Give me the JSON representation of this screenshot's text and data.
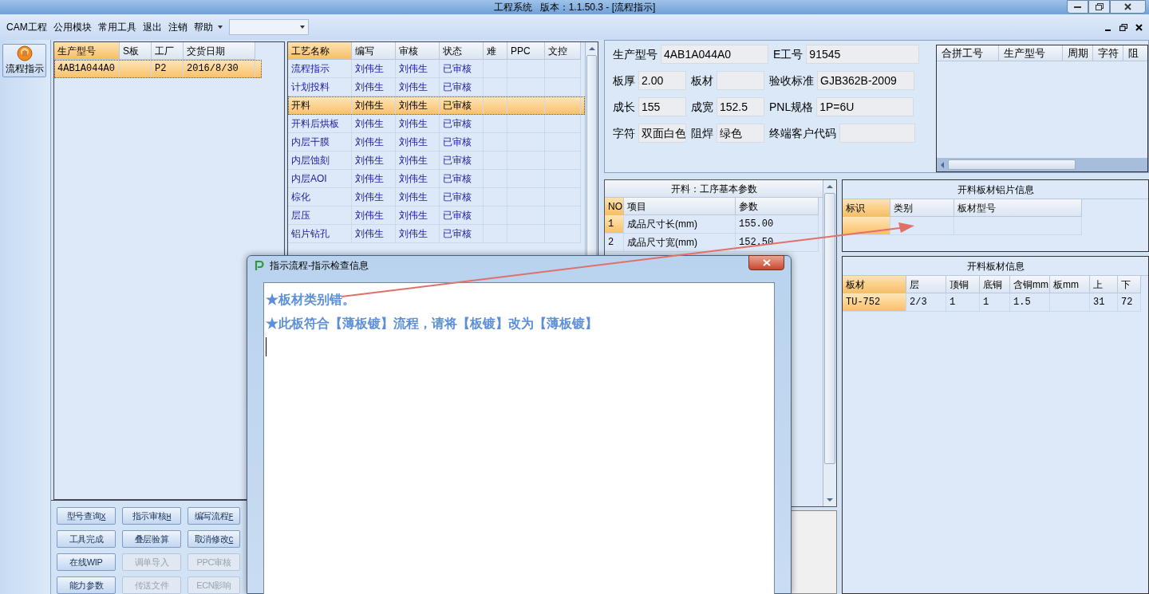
{
  "window": {
    "title": "工程系统   版本：1.1.50.3 - [流程指示]"
  },
  "menu": [
    {
      "label": "CAM工程"
    },
    {
      "label": "公用模块"
    },
    {
      "label": "常用工具"
    },
    {
      "label": "退出"
    },
    {
      "label": "注销"
    },
    {
      "label": "帮助",
      "dropdown": true
    }
  ],
  "nav": [
    {
      "label": "流程指示",
      "selected": true
    }
  ],
  "jobs": {
    "columns": [
      {
        "label": "生产型号",
        "highlighted": true
      },
      {
        "label": "S板",
        "highlighted": false
      },
      {
        "label": "工厂",
        "highlighted": false
      },
      {
        "label": "交货日期",
        "highlighted": false
      }
    ],
    "rows": [
      {
        "model": "4AB1A044A0",
        "factory": "P2",
        "delivery_date": "2016/8/30",
        "selected": true
      }
    ]
  },
  "process": {
    "columns": [
      {
        "label": "工艺名称",
        "highlighted": true
      },
      {
        "label": "编写",
        "highlighted": false
      },
      {
        "label": "审核",
        "highlighted": false
      },
      {
        "label": "状态",
        "highlighted": false
      },
      {
        "label": "难",
        "highlighted": false
      },
      {
        "label": "PPC",
        "highlighted": false
      },
      {
        "label": "文控",
        "highlighted": false
      }
    ],
    "rows": [
      {
        "name": "流程指示",
        "writer": "刘伟生",
        "reviewer": "刘伟生",
        "status": "已审核",
        "selected": false
      },
      {
        "name": "计划投料",
        "writer": "刘伟生",
        "reviewer": "刘伟生",
        "status": "已审核",
        "selected": false
      },
      {
        "name": "开料",
        "writer": "刘伟生",
        "reviewer": "刘伟生",
        "status": "已审核",
        "selected": true
      },
      {
        "name": "开料后烘板",
        "writer": "刘伟生",
        "reviewer": "刘伟生",
        "status": "已审核",
        "selected": false
      },
      {
        "name": "内层干膜",
        "writer": "刘伟生",
        "reviewer": "刘伟生",
        "status": "已审核",
        "selected": false
      },
      {
        "name": "内层蚀刻",
        "writer": "刘伟生",
        "reviewer": "刘伟生",
        "status": "已审核",
        "selected": false
      },
      {
        "name": "内层AOI",
        "writer": "刘伟生",
        "reviewer": "刘伟生",
        "status": "已审核",
        "selected": false
      },
      {
        "name": "棕化",
        "writer": "刘伟生",
        "reviewer": "刘伟生",
        "status": "已审核",
        "selected": false
      },
      {
        "name": "层压",
        "writer": "刘伟生",
        "reviewer": "刘伟生",
        "status": "已审核",
        "selected": false
      },
      {
        "name": "铝片钻孔",
        "writer": "刘伟生",
        "reviewer": "刘伟生",
        "status": "已审核",
        "selected": false
      }
    ]
  },
  "info": [
    [
      {
        "label": "生产型号",
        "value": "4AB1A044A0"
      },
      {
        "label": "E工号",
        "value": "91545"
      }
    ],
    [
      {
        "label": "板厚",
        "value": "2.00"
      },
      {
        "label": "板材"
      },
      {
        "label": "验收标准",
        "value": "GJB362B-2009"
      }
    ],
    [
      {
        "label": "成长",
        "value": "155"
      },
      {
        "label": "成宽",
        "value": "152.5"
      },
      {
        "label": "PNL规格",
        "value": "1P=6U"
      }
    ],
    [
      {
        "label": "字符",
        "value": "双面白色"
      },
      {
        "label": "阻焊",
        "value": "绿色"
      },
      {
        "label": "终端客户代码"
      }
    ]
  ],
  "merge_table": {
    "columns": [
      {
        "label": "合拼工号"
      },
      {
        "label": "生产型号"
      },
      {
        "label": "周期"
      },
      {
        "label": "字符"
      },
      {
        "label": "阻"
      }
    ]
  },
  "params": {
    "title": "开料：工序基本参数",
    "columns": [
      {
        "label": "NO",
        "highlighted": true
      },
      {
        "label": "项目",
        "highlighted": false
      },
      {
        "label": "参数",
        "highlighted": false
      }
    ],
    "rows": [
      {
        "no": "1",
        "item": "成品尺寸长(mm)",
        "value": "155.00",
        "selected": true
      },
      {
        "no": "2",
        "item": "成品尺寸宽(mm)",
        "value": "152.50",
        "selected": false
      }
    ]
  },
  "aluminum": {
    "title": "开料板材铝片信息",
    "columns": [
      {
        "label": "标识",
        "highlighted": true
      },
      {
        "label": "类别",
        "highlighted": false
      },
      {
        "label": "板材型号",
        "highlighted": false
      }
    ],
    "blank_rows": [
      {
        "selected": true
      }
    ]
  },
  "boards": {
    "title": "开料板材信息",
    "columns": [
      {
        "label": "板材",
        "highlighted": true
      },
      {
        "label": "层",
        "highlighted": false
      },
      {
        "label": "顶铜",
        "highlighted": false
      },
      {
        "label": "底铜",
        "highlighted": false
      },
      {
        "label": "含铜mm",
        "highlighted": false
      },
      {
        "label": "板mm",
        "highlighted": false
      },
      {
        "label": "上",
        "highlighted": false
      },
      {
        "label": "下",
        "highlighted": false
      }
    ],
    "rows": [
      {
        "cells": [
          "TU-752",
          "2/3",
          "1",
          "1",
          "1.5",
          null,
          "31",
          "72"
        ],
        "selected": true
      }
    ]
  },
  "buttons": [
    {
      "label": "型号查询",
      "key": "X",
      "disabled": false
    },
    {
      "label": "指示审核",
      "key": "H",
      "disabled": false
    },
    {
      "label": "编写流程",
      "key": "F",
      "disabled": false
    },
    {
      "label": "工具完成",
      "disabled": false
    },
    {
      "label": "叠层验算",
      "disabled": false
    },
    {
      "label": "取消修改",
      "key": "C",
      "disabled": false
    },
    {
      "label": "在线WIP",
      "disabled": false
    },
    {
      "label": "调单导入",
      "disabled": true
    },
    {
      "label": "PPC审核",
      "disabled": true
    },
    {
      "label": "能力参数",
      "disabled": false
    },
    {
      "label": "传送文件",
      "disabled": true
    },
    {
      "label": "ECN影响",
      "disabled": true
    }
  ],
  "dialog": {
    "title": "指示流程-指示检查信息",
    "lines": [
      "★板材类别错。",
      "★此板符合【薄板镀】流程，请将【板镀】改为【薄板镀】"
    ]
  }
}
